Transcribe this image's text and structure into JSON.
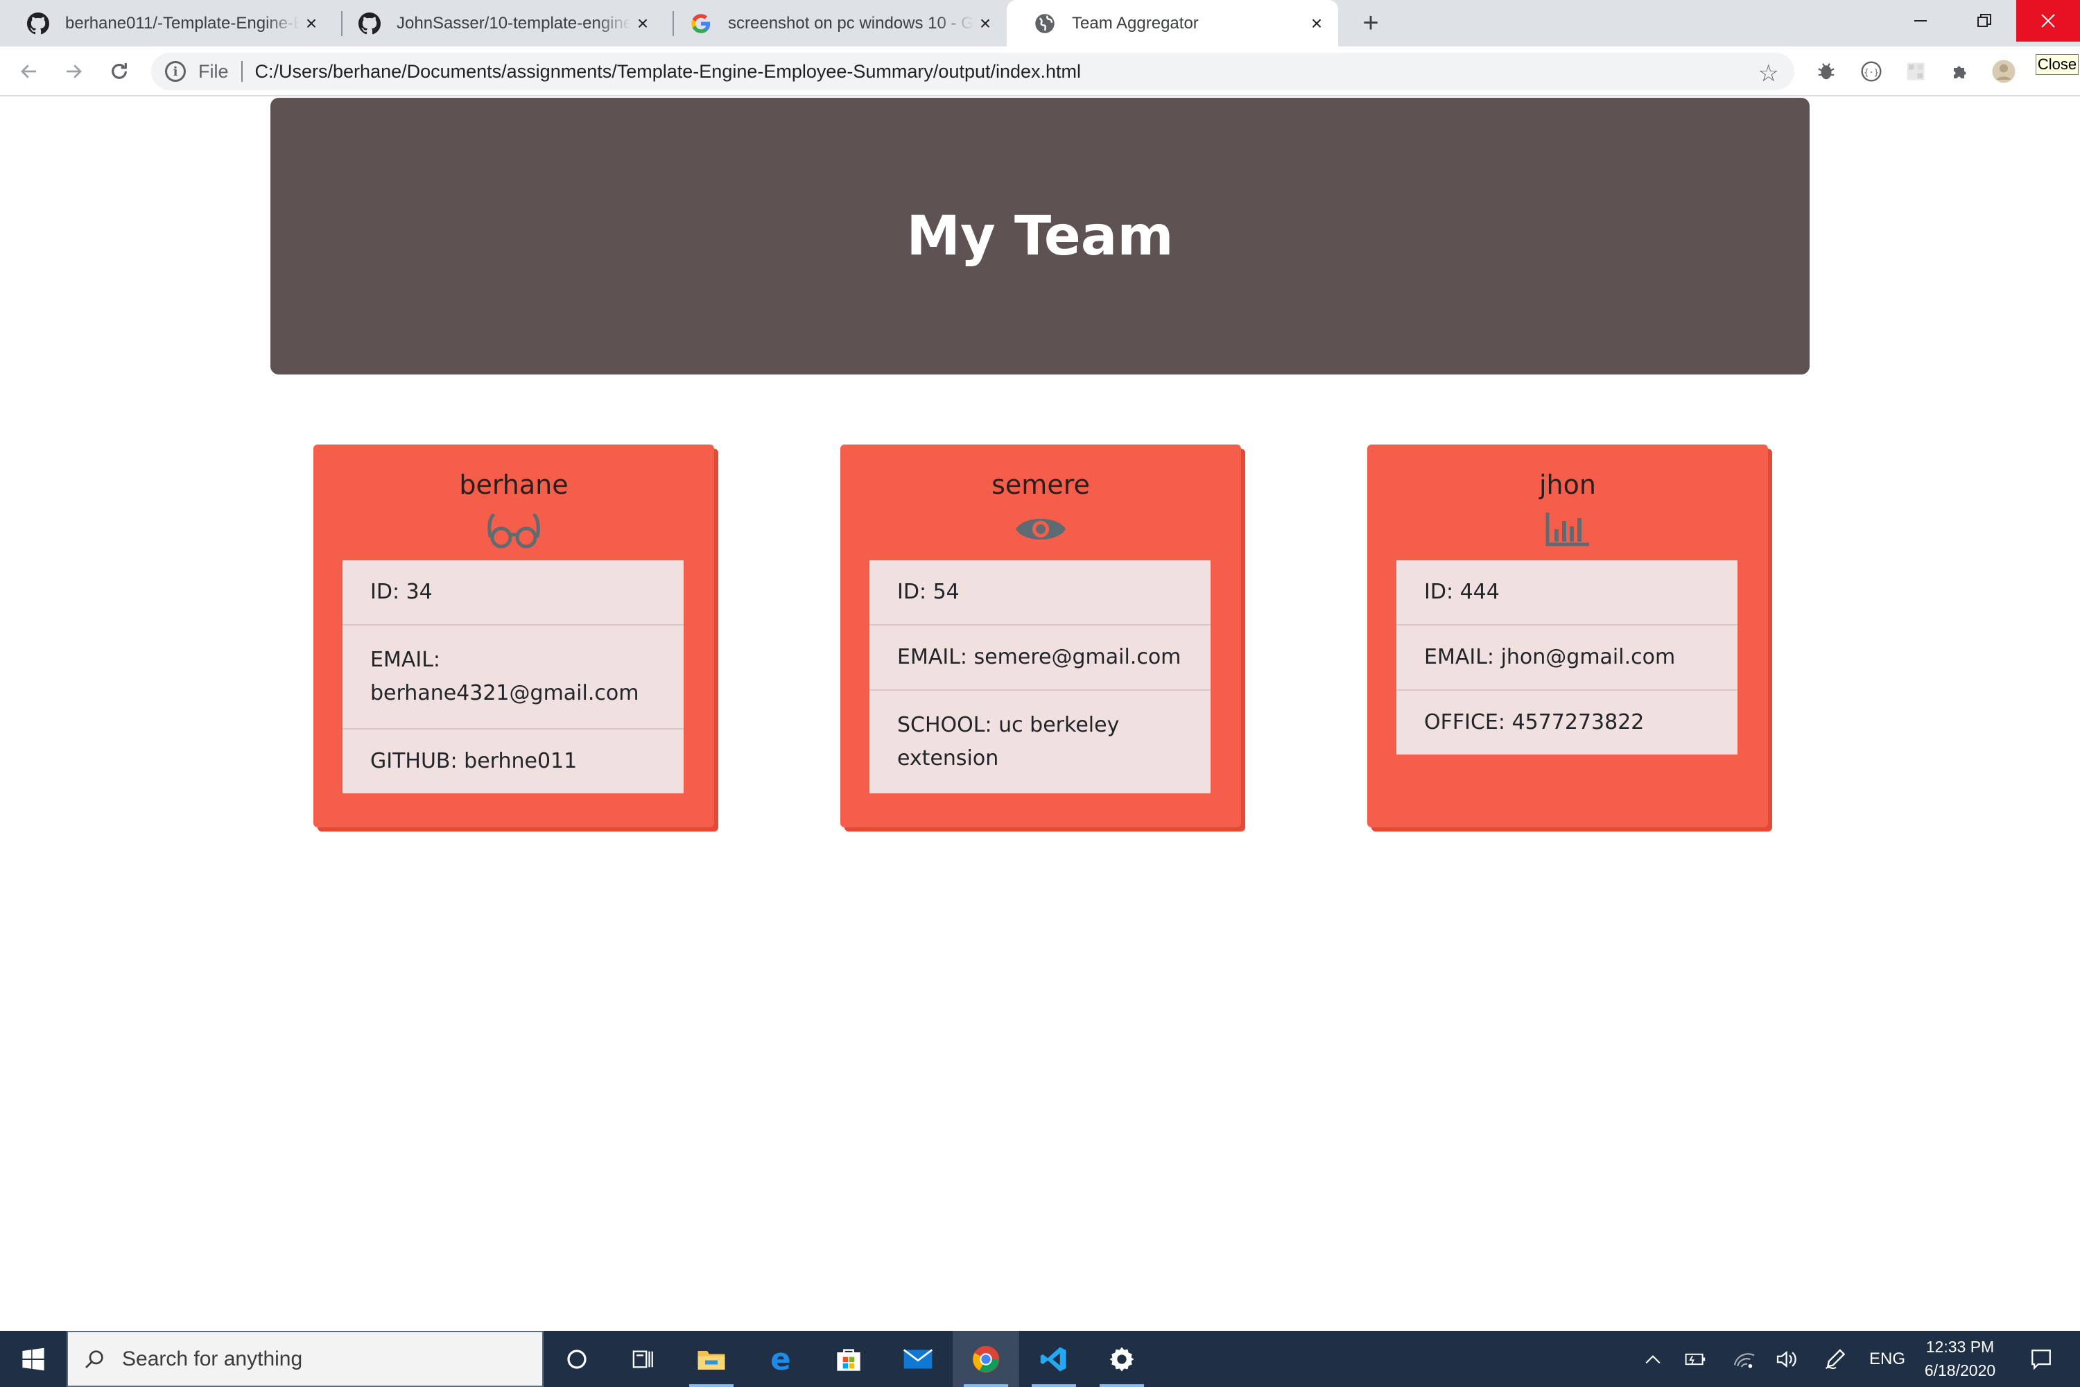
{
  "browser": {
    "tabs": [
      {
        "title": "berhane011/-Template-Engine-E",
        "icon": "github-icon",
        "active": false
      },
      {
        "title": "JohnSasser/10-template-engine",
        "icon": "github-icon",
        "active": false
      },
      {
        "title": "screenshot on pc windows 10 - G",
        "icon": "google-icon",
        "active": false
      },
      {
        "title": "Team Aggregator",
        "icon": "globe-icon",
        "active": true
      }
    ],
    "new_tab": "+",
    "tab_close": "×",
    "omnibox": {
      "scheme_label": "File",
      "url": "C:/Users/berhane/Documents/assignments/Template-Engine-Employee-Summary/output/index.html"
    },
    "tooltip": "Close"
  },
  "page": {
    "title": "My Team",
    "colors": {
      "header_bg": "#5e5252",
      "card_bg": "#f45e4a",
      "list_bg": "#f0e0df",
      "icon": "#5f6b73"
    },
    "cards": [
      {
        "name": "berhane",
        "role_icon": "glasses-icon",
        "rows": [
          {
            "label": "ID: 34"
          },
          {
            "label": "EMAIL: berhane4321@gmail.com"
          },
          {
            "label": "GITHUB: berhne011"
          }
        ]
      },
      {
        "name": "semere",
        "role_icon": "eye-icon",
        "rows": [
          {
            "label": "ID: 54"
          },
          {
            "label": "EMAIL: semere@gmail.com"
          },
          {
            "label": "SCHOOL: uc berkeley extension"
          }
        ]
      },
      {
        "name": "jhon",
        "role_icon": "bar-chart-icon",
        "rows": [
          {
            "label": "ID: 444"
          },
          {
            "label": "EMAIL: jhon@gmail.com"
          },
          {
            "label": "OFFICE: 4577273822"
          }
        ]
      }
    ]
  },
  "taskbar": {
    "search_placeholder": "Search for anything",
    "apps": [
      "cortana-icon",
      "task-view-icon",
      "file-explorer-icon",
      "edge-icon",
      "store-icon",
      "mail-icon",
      "chrome-icon",
      "vscode-icon",
      "settings-icon"
    ],
    "language": "ENG",
    "time": "12:33 PM",
    "date": "6/18/2020"
  }
}
